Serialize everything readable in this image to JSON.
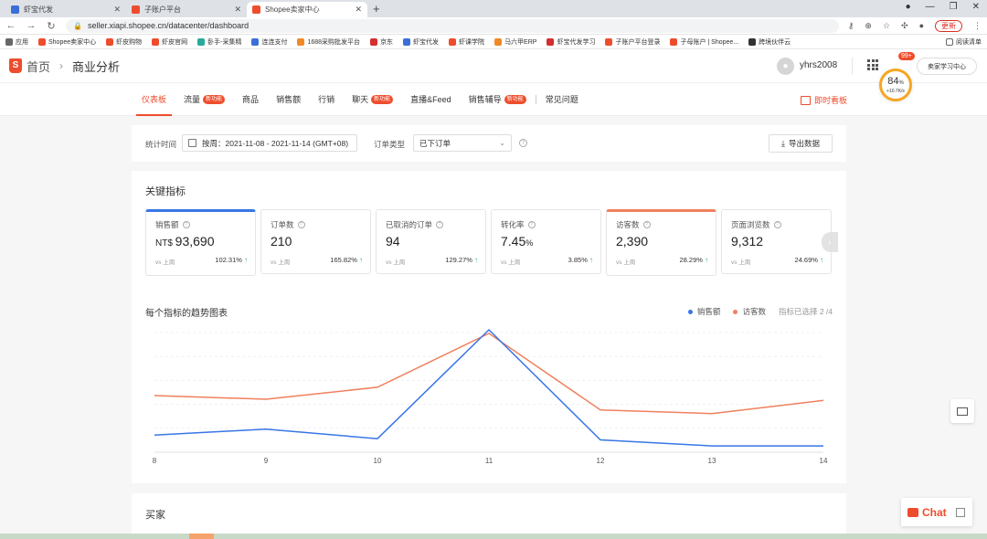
{
  "browser": {
    "tabs": [
      {
        "title": "虾宝代发",
        "color": "#3a6fd8"
      },
      {
        "title": "子账户平台",
        "color": "#ee4d2d"
      },
      {
        "title": "Shopee卖家中心",
        "color": "#ee4d2d",
        "active": true
      }
    ],
    "url": "seller.xiapi.shopee.cn/datacenter/dashboard",
    "update_label": "更新",
    "bookmarks": [
      {
        "label": "应用",
        "color": "#666"
      },
      {
        "label": "Shopee卖家中心",
        "color": "#ee4d2d"
      },
      {
        "label": "虾皮购物",
        "color": "#ee4d2d"
      },
      {
        "label": "虾皮官网",
        "color": "#ee4d2d"
      },
      {
        "label": "卧手-采集精",
        "color": "#26aa99"
      },
      {
        "label": "连连支付",
        "color": "#3a6fd8"
      },
      {
        "label": "1688采购批发平台",
        "color": "#f08a24"
      },
      {
        "label": "京东",
        "color": "#d32f2f"
      },
      {
        "label": "虾宝代发",
        "color": "#3a6fd8"
      },
      {
        "label": "虾课学院",
        "color": "#ee4d2d"
      },
      {
        "label": "马六甲ERP",
        "color": "#f08a24"
      },
      {
        "label": "虾宝代发学习",
        "color": "#d32f2f"
      },
      {
        "label": "子账户平台登录",
        "color": "#ee4d2d"
      },
      {
        "label": "子母账户 | Shopee...",
        "color": "#ee4d2d"
      },
      {
        "label": "跨境伙伴云",
        "color": "#333"
      }
    ],
    "reading_list": "阅读清单"
  },
  "header": {
    "home": "首页",
    "current": "商业分析",
    "username": "yhrs2008",
    "badge": "99+",
    "learn_center": "卖家学习中心",
    "perf_value": "84",
    "perf_unit": "%",
    "perf_sub": "+10.7K/s"
  },
  "subnav": {
    "items": [
      {
        "label": "仪表板",
        "active": true
      },
      {
        "label": "流量",
        "tag": "新功能"
      },
      {
        "label": "商品"
      },
      {
        "label": "销售额"
      },
      {
        "label": "行销"
      },
      {
        "label": "聊天",
        "tag": "新功能"
      },
      {
        "label": "直播&Feed"
      },
      {
        "label": "销售辅导",
        "tag": "新功能"
      },
      {
        "label": "常见问题",
        "sep": true
      }
    ],
    "realtime": "即时看板"
  },
  "filters": {
    "time_label": "统计时间",
    "date_range": "按周：2021-11-08 - 2021-11-14 (GMT+08)",
    "order_type_label": "订单类型",
    "order_type_value": "已下订单",
    "export": "导出数据"
  },
  "key_metrics": {
    "title": "关键指标",
    "vs_label": "vs 上周",
    "items": [
      {
        "label": "销售额",
        "prefix": "NT$ ",
        "value": "93,690",
        "change": "102.31%",
        "selected": "blue"
      },
      {
        "label": "订单数",
        "value": "210",
        "change": "165.82%"
      },
      {
        "label": "已取消的订单",
        "value": "94",
        "change": "129.27%"
      },
      {
        "label": "转化率",
        "value": "7.45",
        "suffix": "%",
        "change": "3.85%"
      },
      {
        "label": "访客数",
        "value": "2,390",
        "change": "28.29%",
        "selected": "orange"
      },
      {
        "label": "页面浏览数",
        "value": "9,312",
        "change": "24.69%"
      }
    ]
  },
  "trend": {
    "title": "每个指标的趋势图表",
    "selected_text": "指标已选择 2 /4"
  },
  "chart_data": {
    "type": "line",
    "title": "每个指标的趋势图表",
    "x": [
      "8",
      "9",
      "10",
      "11",
      "12",
      "13",
      "14"
    ],
    "series": [
      {
        "name": "销售额",
        "color": "#3876e6",
        "values": [
          12,
          17,
          9,
          100,
          8,
          3,
          3
        ]
      },
      {
        "name": "访客数",
        "color": "#f0805d",
        "values": [
          45,
          42,
          52,
          97,
          33,
          30,
          41
        ]
      }
    ],
    "ylim": [
      0,
      100
    ],
    "grid": true,
    "legend": "top-right"
  },
  "buyers": {
    "title": "买家"
  },
  "floating": {
    "chat": "Chat"
  }
}
